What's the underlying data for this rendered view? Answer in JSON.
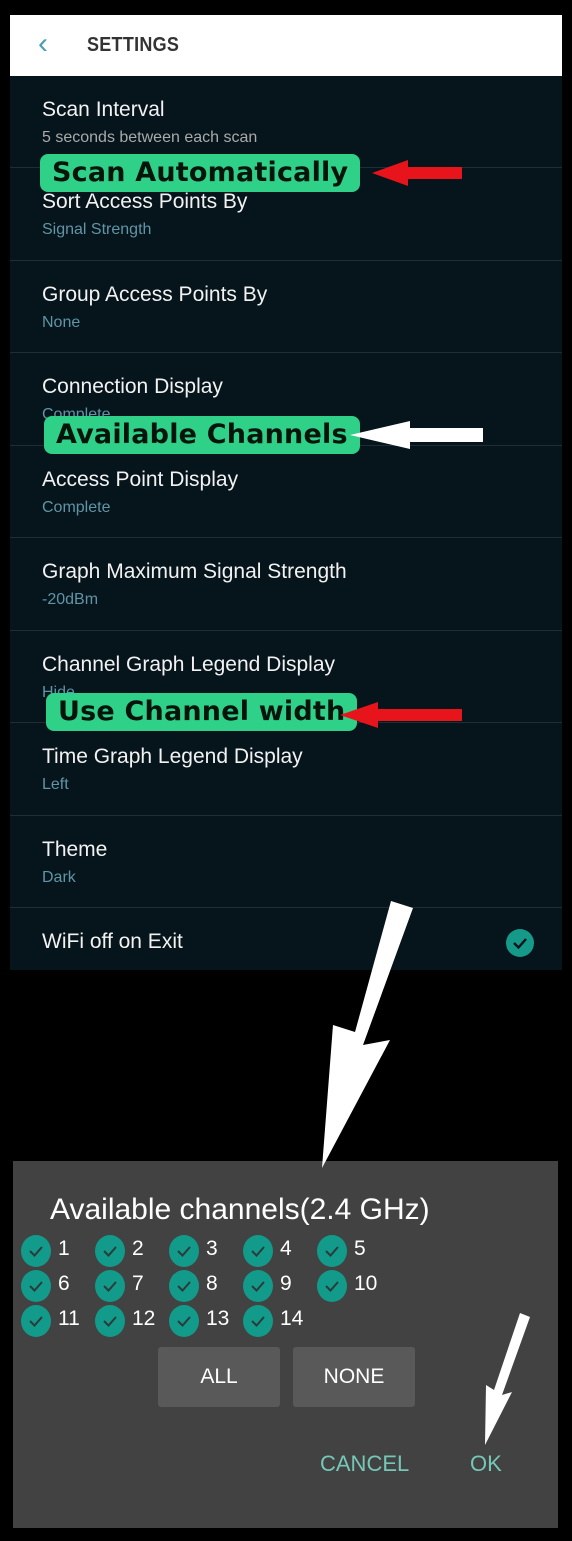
{
  "header": {
    "title": "SETTINGS",
    "back_icon": "chevron-left-icon"
  },
  "settings": [
    {
      "title": "Scan Interval",
      "value": "5 seconds between each scan"
    },
    {
      "title": "Sort Access Points By",
      "value": "Signal Strength"
    },
    {
      "title": "Group Access Points By",
      "value": "None"
    },
    {
      "title": "Connection Display",
      "value": "Complete"
    },
    {
      "title": "Access Point Display",
      "value": "Complete"
    },
    {
      "title": "Graph Maximum Signal Strength",
      "value": "-20dBm"
    },
    {
      "title": "Channel Graph Legend Display",
      "value": "Hide"
    },
    {
      "title": "Time Graph Legend Display",
      "value": "Left"
    },
    {
      "title": "Theme",
      "value": "Dark"
    },
    {
      "title": "WiFi off on Exit",
      "checked": true
    }
  ],
  "annotations": {
    "scan_automatically": "Scan Automatically",
    "available_channels": "Available Channels",
    "use_channel_width": "Use Channel width"
  },
  "dialog": {
    "title": "Available channels(2.4 GHz)",
    "channels": [
      {
        "n": "1",
        "checked": true
      },
      {
        "n": "2",
        "checked": true
      },
      {
        "n": "3",
        "checked": true
      },
      {
        "n": "4",
        "checked": true
      },
      {
        "n": "5",
        "checked": true
      },
      {
        "n": "6",
        "checked": true
      },
      {
        "n": "7",
        "checked": true
      },
      {
        "n": "8",
        "checked": true
      },
      {
        "n": "9",
        "checked": true
      },
      {
        "n": "10",
        "checked": true
      },
      {
        "n": "11",
        "checked": true
      },
      {
        "n": "12",
        "checked": true
      },
      {
        "n": "13",
        "checked": true
      },
      {
        "n": "14",
        "checked": true
      }
    ],
    "all_label": "ALL",
    "none_label": "NONE",
    "cancel_label": "CANCEL",
    "ok_label": "OK"
  },
  "colors": {
    "accent": "#159a8a",
    "label_bg": "#2fd087",
    "arrow_red": "#e8141b",
    "dialog_bg": "#424242"
  }
}
